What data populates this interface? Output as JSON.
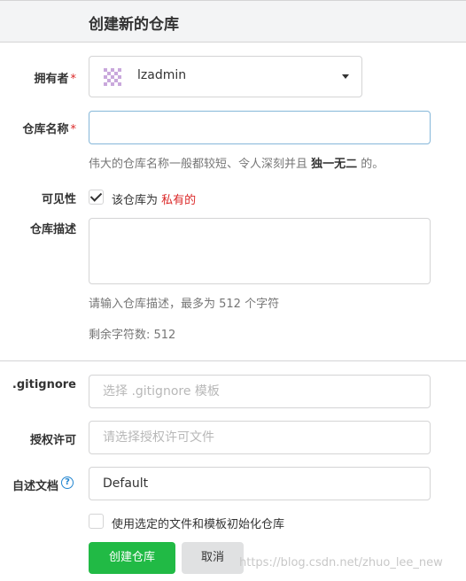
{
  "header": {
    "title": "创建新的仓库"
  },
  "owner": {
    "label": "拥有者",
    "required_mark": "*",
    "value": "lzadmin"
  },
  "repo_name": {
    "label": "仓库名称",
    "required_mark": "*",
    "value": "",
    "help_prefix": "伟大的仓库名称一般都较短、令人深刻并且 ",
    "help_strong": "独一无二",
    "help_suffix": " 的。"
  },
  "visibility": {
    "label": "可见性",
    "checked": true,
    "text_prefix": "该仓库为 ",
    "text_private": "私有的"
  },
  "description": {
    "label": "仓库描述",
    "value": "",
    "help": "请输入仓库描述，最多为 512 个字符",
    "remaining": "剩余字符数: 512"
  },
  "gitignore": {
    "label": ".gitignore",
    "placeholder": "选择 .gitignore 模板"
  },
  "license": {
    "label": "授权许可",
    "placeholder": "请选择授权许可文件"
  },
  "readme": {
    "label": "自述文档",
    "value": "Default",
    "help_icon": "question-circle-icon"
  },
  "auto_init": {
    "checked": false,
    "label": "使用选定的文件和模板初始化仓库"
  },
  "buttons": {
    "create": "创建仓库",
    "cancel": "取消"
  },
  "watermark": "https://blog.csdn.net/zhuo_lee_new",
  "colors": {
    "primary": "#21ba45",
    "required": "#db2828",
    "private": "#db2828",
    "focus_border": "#85b7d9",
    "link": "#2185d0"
  }
}
